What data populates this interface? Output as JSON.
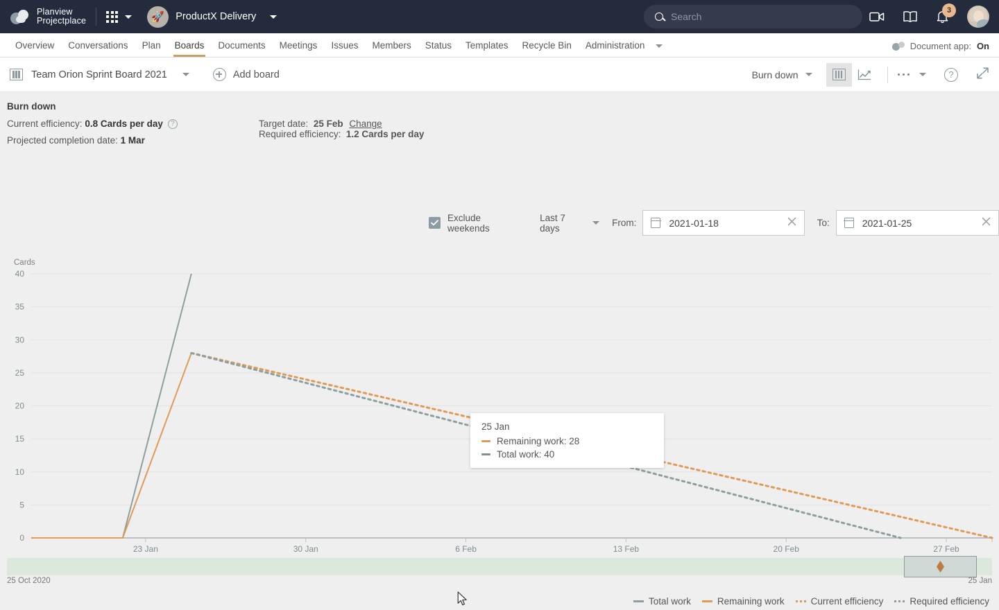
{
  "topbar": {
    "logo_line1": "Planview",
    "logo_line2": "Projectplace",
    "apps_icon": "grid-apps-icon",
    "project_name": "ProductX Delivery",
    "project_avatar_glyph": "🚀",
    "search_placeholder": "Search",
    "search_value": "",
    "notification_count": "3"
  },
  "nav": {
    "items": [
      {
        "label": "Overview",
        "active": false
      },
      {
        "label": "Conversations",
        "active": false
      },
      {
        "label": "Plan",
        "active": false
      },
      {
        "label": "Boards",
        "active": true
      },
      {
        "label": "Documents",
        "active": false
      },
      {
        "label": "Meetings",
        "active": false
      },
      {
        "label": "Issues",
        "active": false
      },
      {
        "label": "Members",
        "active": false
      },
      {
        "label": "Status",
        "active": false
      },
      {
        "label": "Templates",
        "active": false
      },
      {
        "label": "Recycle Bin",
        "active": false
      },
      {
        "label": "Administration",
        "active": false
      }
    ],
    "document_app_label": "Document app:",
    "document_app_state": "On"
  },
  "toolbar": {
    "board_name": "Team Orion Sprint Board 2021",
    "add_board_label": "Add board",
    "chart_type": "Burn down"
  },
  "panel": {
    "title": "Burn down",
    "current_efficiency_label": "Current efficiency:",
    "current_efficiency_value": "0.8 Cards per day",
    "projected_completion_label": "Projected completion date:",
    "projected_completion_value": "1 Mar",
    "target_date_label": "Target date:",
    "target_date_value": "25 Feb",
    "change_link": "Change",
    "required_efficiency_label": "Required efficiency:",
    "required_efficiency_value": "1.2 Cards per day"
  },
  "filters": {
    "exclude_weekends_label": "Exclude weekends",
    "exclude_weekends_checked": true,
    "range_preset": "Last 7 days",
    "from_label": "From:",
    "from_value": "2021-01-18",
    "to_label": "To:",
    "to_value": "2021-01-25"
  },
  "tooltip": {
    "date": "25 Jan",
    "rows": [
      {
        "label": "Remaining work: 28",
        "color": "#e09a55"
      },
      {
        "label": "Total work: 40",
        "color": "#7d9294"
      }
    ]
  },
  "slider": {
    "start_label": "25 Oct 2020",
    "end_label": "25 Jan"
  },
  "chart_data": {
    "type": "line",
    "title": "Burn down",
    "xlabel": "",
    "ylabel": "Cards",
    "ylim": [
      0,
      40
    ],
    "yticks": [
      0,
      5,
      10,
      15,
      20,
      25,
      30,
      35,
      40
    ],
    "xticks": [
      "23 Jan",
      "30 Jan",
      "6 Feb",
      "13 Feb",
      "20 Feb",
      "27 Feb"
    ],
    "grid": true,
    "legend_position": "bottom-right",
    "legend": [
      {
        "name": "Total work",
        "color": "#8c9fa0",
        "style": "solid"
      },
      {
        "name": "Remaining work",
        "color": "#e09a55",
        "style": "solid"
      },
      {
        "name": "Current efficiency",
        "color": "#e09a55",
        "style": "dotted"
      },
      {
        "name": "Required efficiency",
        "color": "#8c9fa0",
        "style": "dotted"
      }
    ],
    "series": [
      {
        "name": "Total work",
        "color": "#8c9fa0",
        "style": "solid",
        "points": [
          [
            "18 Jan",
            0
          ],
          [
            "22 Jan",
            0
          ],
          [
            "25 Jan",
            40
          ]
        ]
      },
      {
        "name": "Remaining work",
        "color": "#e09a55",
        "style": "solid",
        "points": [
          [
            "18 Jan",
            0
          ],
          [
            "22 Jan",
            0
          ],
          [
            "25 Jan",
            28
          ]
        ]
      },
      {
        "name": "Current efficiency",
        "color": "#e09a55",
        "style": "dotted",
        "points": [
          [
            "25 Jan",
            28
          ],
          [
            "1 Mar",
            0
          ]
        ]
      },
      {
        "name": "Required efficiency",
        "color": "#8c9fa0",
        "style": "dotted",
        "points": [
          [
            "25 Jan",
            28
          ],
          [
            "25 Feb",
            0
          ]
        ]
      }
    ]
  }
}
